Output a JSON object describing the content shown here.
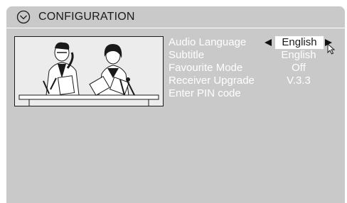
{
  "title": {
    "text": "CONFIGURATION",
    "icon": "chevron-circle-down-icon"
  },
  "preview": {
    "description_icon": "news-anchors-illustration"
  },
  "menu": {
    "items": [
      {
        "label": "Audio Language",
        "value": "English",
        "selected": true
      },
      {
        "label": "Subtitle",
        "value": "English",
        "selected": false
      },
      {
        "label": "Favourite Mode",
        "value": "Off",
        "selected": false
      },
      {
        "label": "Receiver Upgrade",
        "value": "V.3.3",
        "selected": false
      },
      {
        "label": "Enter PIN code",
        "value": "",
        "selected": false
      }
    ]
  },
  "colors": {
    "panel": "#c9c9c9",
    "text_primary": "#ffffff",
    "highlight": "#ffffff",
    "highlight_text": "#1a1a1a"
  }
}
